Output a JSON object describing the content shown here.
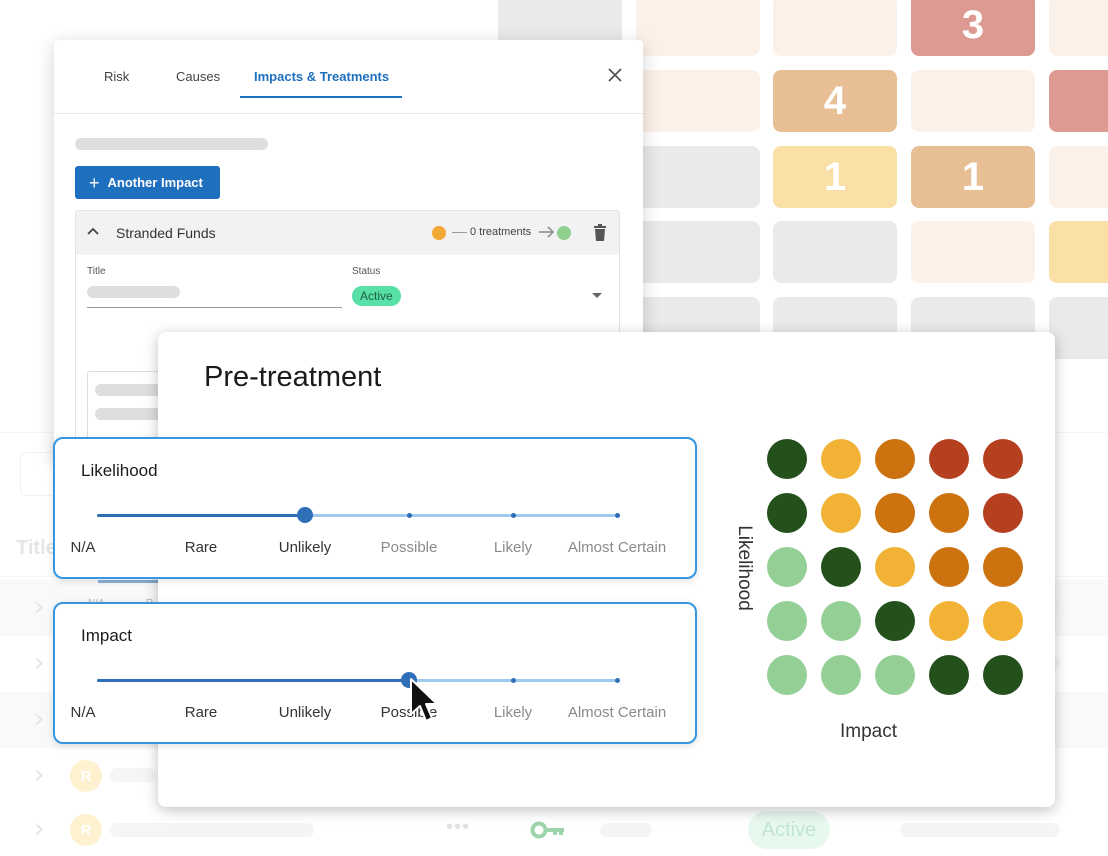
{
  "colors": {
    "primary": "#1f6fbf",
    "slider_fill": "#2e6fb8",
    "slider_track": "#9fcaf0",
    "status_active": "#58e0a7",
    "likelihood_before": "#f2a935",
    "treated_dot": "#8fd08f",
    "matrix": {
      "dark_green": "#24501c",
      "light_green": "#94cf95",
      "yellow": "#f1b236",
      "orange": "#cc720f",
      "red": "#b5401f"
    }
  },
  "background": {
    "heatmap_counts": [
      "3",
      "4",
      "1",
      "1"
    ],
    "table_title": "Title",
    "row_avatar": "R",
    "row_status": "Active",
    "background_slider_labels": [
      "N/A",
      "R"
    ]
  },
  "dialog": {
    "tabs": [
      "Risk",
      "Causes",
      "Impacts & Treatments"
    ],
    "active_tab": "Impacts & Treatments",
    "add_button": "Another Impact",
    "impact": {
      "name": "Stranded Funds",
      "treatments_text": "0 treatments",
      "title_label": "Title",
      "status_label": "Status",
      "status_value": "Active"
    }
  },
  "pretreatment": {
    "title": "Pre-treatment",
    "likelihood": {
      "label": "Likelihood",
      "options": [
        "N/A",
        "Rare",
        "Unlikely",
        "Possible",
        "Likely",
        "Almost Certain"
      ],
      "selected_index": 2
    },
    "impact": {
      "label": "Impact",
      "options": [
        "N/A",
        "Rare",
        "Unlikely",
        "Possible",
        "Likely",
        "Almost Certain"
      ],
      "selected_index": 3
    },
    "matrix": {
      "y_axis_label": "Likelihood",
      "x_axis_label": "Impact",
      "rows": [
        [
          "dark_green",
          "yellow",
          "orange",
          "red",
          "red"
        ],
        [
          "dark_green",
          "yellow",
          "orange",
          "orange",
          "red"
        ],
        [
          "light_green",
          "dark_green",
          "yellow",
          "orange",
          "orange"
        ],
        [
          "light_green",
          "light_green",
          "dark_green",
          "yellow",
          "yellow"
        ],
        [
          "light_green",
          "light_green",
          "light_green",
          "dark_green",
          "dark_green"
        ]
      ]
    }
  }
}
